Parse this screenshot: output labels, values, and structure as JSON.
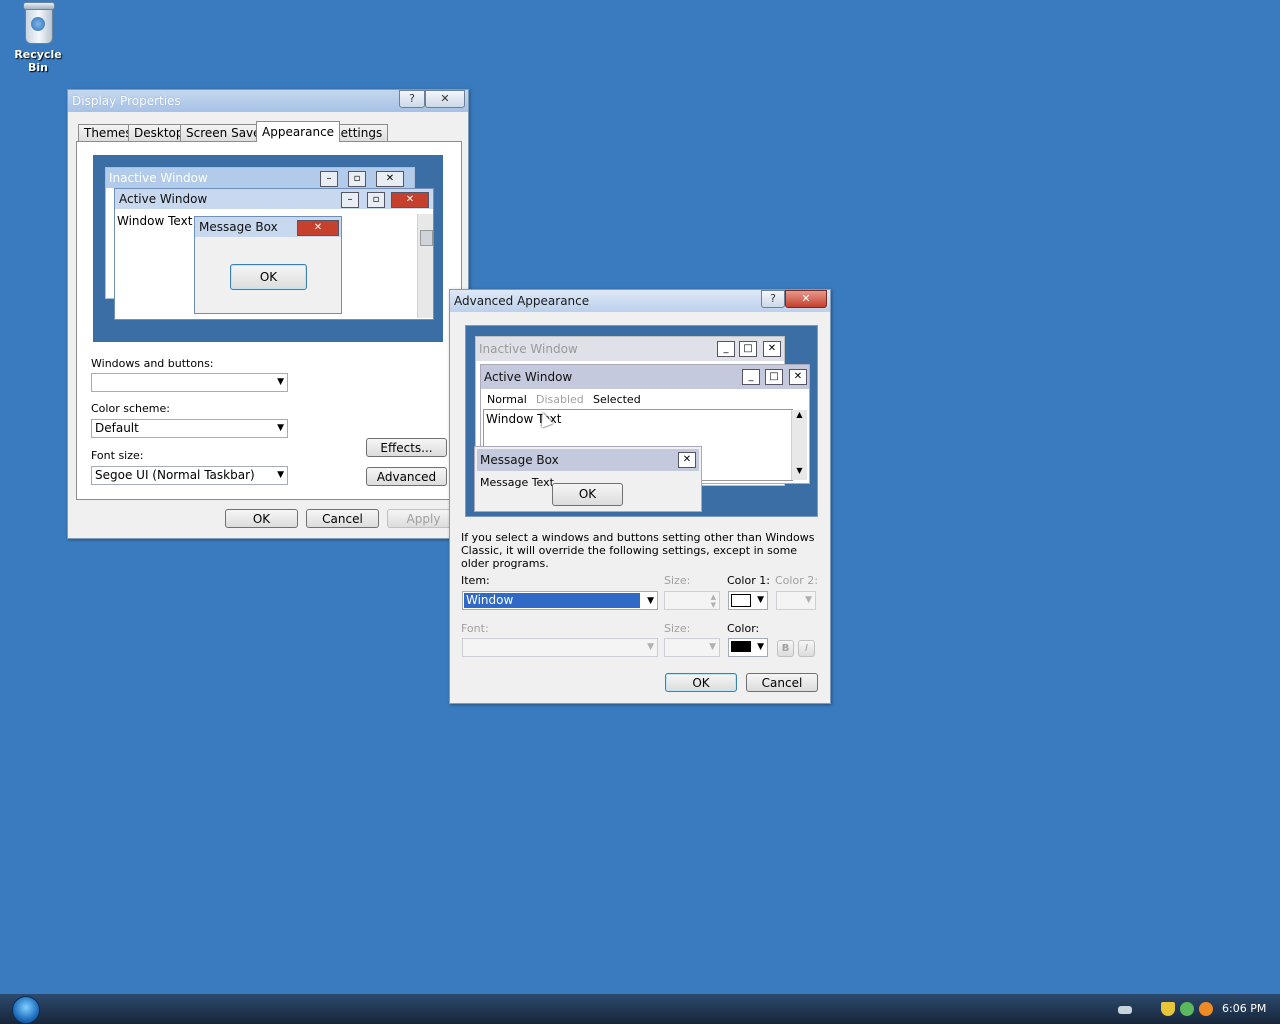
{
  "desktop": {
    "recycle_bin_label": "Recycle Bin"
  },
  "display_properties": {
    "title": "Display Properties",
    "help_btn": "?",
    "close_btn": "✕",
    "tabs": [
      "Themes",
      "Desktop",
      "Screen Saver",
      "Appearance",
      "Settings"
    ],
    "selected_tab": "Appearance",
    "preview": {
      "inactive_title": "Inactive Window",
      "active_title": "Active Window",
      "window_text": "Window Text",
      "message_box_title": "Message Box",
      "ok_label": "OK"
    },
    "windows_and_buttons_label": "Windows and buttons:",
    "windows_and_buttons_value": "",
    "color_scheme_label": "Color scheme:",
    "color_scheme_value": "Default",
    "font_size_label": "Font size:",
    "font_size_value": "Segoe UI (Normal Taskbar)",
    "effects_label": "Effects...",
    "advanced_label": "Advanced",
    "ok_label": "OK",
    "cancel_label": "Cancel",
    "apply_label": "Apply"
  },
  "advanced_appearance": {
    "title": "Advanced Appearance",
    "help_btn": "?",
    "close_btn": "✕",
    "preview": {
      "inactive_title": "Inactive Window",
      "active_title": "Active Window",
      "menu_normal": "Normal",
      "menu_disabled": "Disabled",
      "menu_selected": "Selected",
      "window_text": "Window Text",
      "message_box_title": "Message Box",
      "message_text": "Message Text",
      "ok_label": "OK"
    },
    "description": "If you select a windows and buttons setting other than Windows Classic, it will override the following settings, except in some older programs.",
    "item_label": "Item:",
    "item_value": "Window",
    "size_label": "Size:",
    "color1_label": "Color 1:",
    "color2_label": "Color 2:",
    "font_label": "Font:",
    "font_size_label": "Size:",
    "font_color_label": "Color:",
    "bold_label": "B",
    "italic_label": "I",
    "ok_label": "OK",
    "cancel_label": "Cancel"
  },
  "taskbar": {
    "clock": "6:06 PM"
  },
  "colors": {
    "desktop": "#3a7bbf",
    "selection": "#3169c6",
    "preview_bg": "#3a6ea5"
  }
}
